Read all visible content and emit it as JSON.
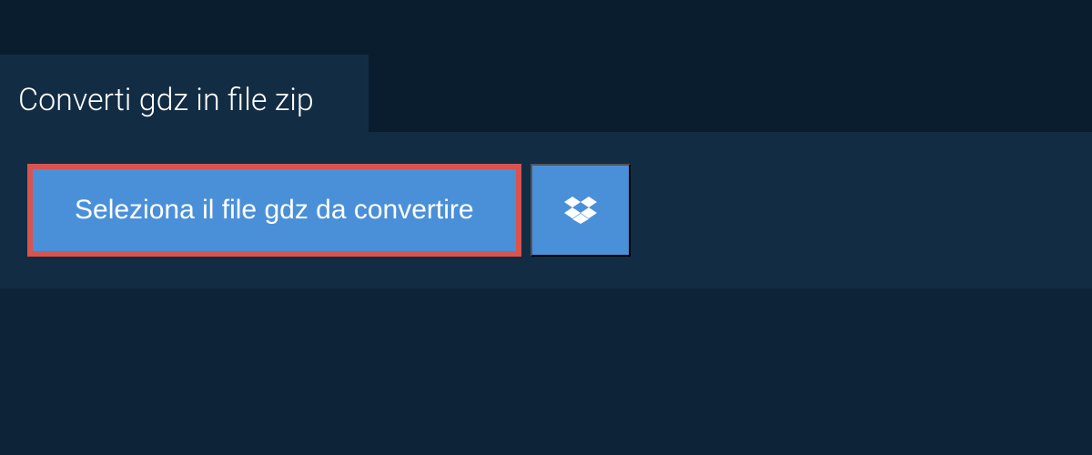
{
  "header": {
    "title": "Converti gdz in file zip"
  },
  "actions": {
    "select_file_label": "Seleziona il file gdz da convertire",
    "dropbox_icon": "dropbox"
  },
  "colors": {
    "bg_dark": "#0d2438",
    "bg_darker": "#0a1d2e",
    "bg_panel": "#122c44",
    "button_blue": "#4a90d9",
    "border_red": "#d9534f",
    "text_white": "#ffffff"
  }
}
